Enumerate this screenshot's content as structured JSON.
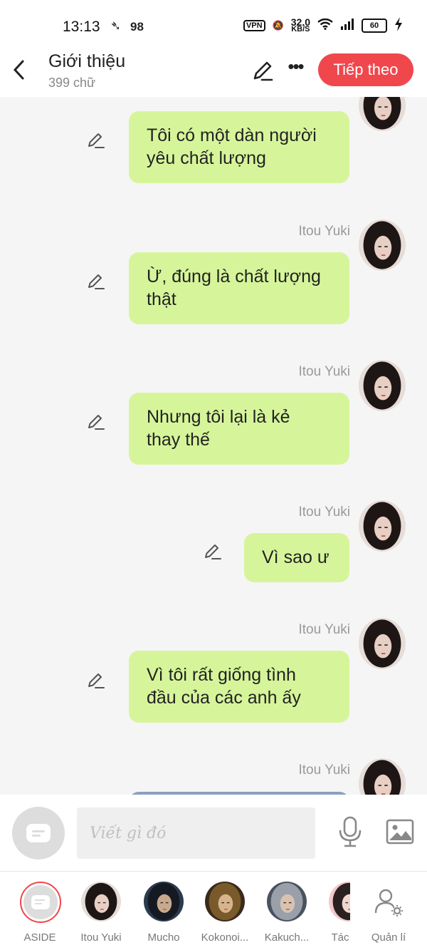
{
  "status": {
    "time": "13:13",
    "battery_level": "98",
    "vpn_label": "VPN",
    "net_speed_value": "32.0",
    "net_speed_unit": "KB/S",
    "battery_percent": "60"
  },
  "header": {
    "title": "Giới thiệu",
    "subtitle": "399 chữ",
    "next_label": "Tiếp theo"
  },
  "messages": [
    {
      "sender": "",
      "text": "Tôi có một dàn người\nyêu chất lượng"
    },
    {
      "sender": "Itou Yuki",
      "text": "Ừ, đúng là chất lượng\nthật"
    },
    {
      "sender": "Itou Yuki",
      "text": "Nhưng tôi lại là kẻ\nthay thế"
    },
    {
      "sender": "Itou Yuki",
      "text": "Vì sao ư"
    },
    {
      "sender": "Itou Yuki",
      "text": "Vì tôi rất giống tình\nđầu của các anh ấy"
    },
    {
      "sender": "Itou Yuki",
      "text": ""
    }
  ],
  "composer": {
    "placeholder": "Viết gì đó"
  },
  "tabs": [
    {
      "label": "ASIDE"
    },
    {
      "label": "Itou Yuki"
    },
    {
      "label": "Mucho"
    },
    {
      "label": "Kokonoi..."
    },
    {
      "label": "Kakuch..."
    },
    {
      "label": "Tác"
    },
    {
      "label": "Quản lí"
    }
  ],
  "colors": {
    "accent": "#f0474d",
    "bubble": "#d6f59a",
    "background": "#f5f5f5"
  }
}
